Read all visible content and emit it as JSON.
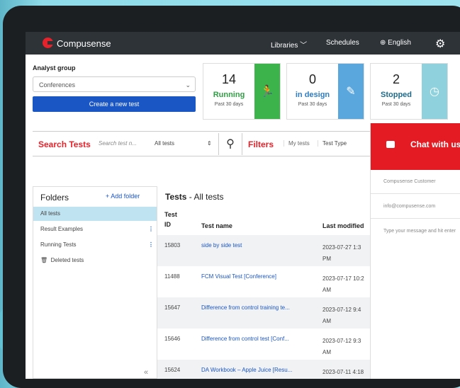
{
  "nav": {
    "brand": "Compusense",
    "libraries": "Libraries",
    "schedules": "Schedules",
    "language": "English"
  },
  "analyst": {
    "label": "Analyst group",
    "selected": "Conferences",
    "create_label": "Create a new test"
  },
  "cards": [
    {
      "number": "14",
      "label": "Running",
      "sub": "Past 30 days",
      "color": "#2fa043",
      "side_color": "#3cb44b",
      "icon": "runner-icon"
    },
    {
      "number": "0",
      "label": "in design",
      "sub": "Past 30 days",
      "color": "#2b7cc4",
      "side_color": "#5aa7dd",
      "icon": "pencil-icon"
    },
    {
      "number": "2",
      "label": "Stopped",
      "sub": "Past 30 days",
      "color": "#1d6b8c",
      "side_color": "#8fd1dc",
      "icon": "clock-icon"
    }
  ],
  "search": {
    "title": "Search Tests",
    "placeholder": "Search test n...",
    "scope": "All tests",
    "filters_title": "Filters",
    "my_tests": "My tests",
    "test_type": "Test Type"
  },
  "folders": {
    "title": "Folders",
    "add_label": "+ Add folder",
    "items": [
      "All tests",
      "Result Examples",
      "Running Tests",
      "Deleted tests"
    ]
  },
  "tests": {
    "title_bold": "Tests",
    "title_rest": " - All tests",
    "headers": {
      "id_line1": "Test",
      "id_line2": "ID",
      "name": "Test name",
      "modified": "Last modified"
    },
    "rows": [
      {
        "id": "15803",
        "name": "side by side test",
        "date1": "2023-07-27 1:3",
        "date2": "PM"
      },
      {
        "id": "11488",
        "name": "FCM Visual Test [Conference]",
        "date1": "2023-07-17 10:2",
        "date2": "AM"
      },
      {
        "id": "15647",
        "name": "Difference from control training te...",
        "date1": "2023-07-12 9:4",
        "date2": "AM"
      },
      {
        "id": "15646",
        "name": "Difference from control test [Conf...",
        "date1": "2023-07-12 9:3",
        "date2": "AM"
      },
      {
        "id": "15624",
        "name": "DA Workbook – Apple Juice [Resu...",
        "date1": "2023-07-11 4:18",
        "date2": ""
      }
    ]
  },
  "chat": {
    "title": "Chat with us",
    "name_field": "Compusense Customer",
    "email_field": "info@compusense.com",
    "message_placeholder": "Type your message and hit enter"
  }
}
